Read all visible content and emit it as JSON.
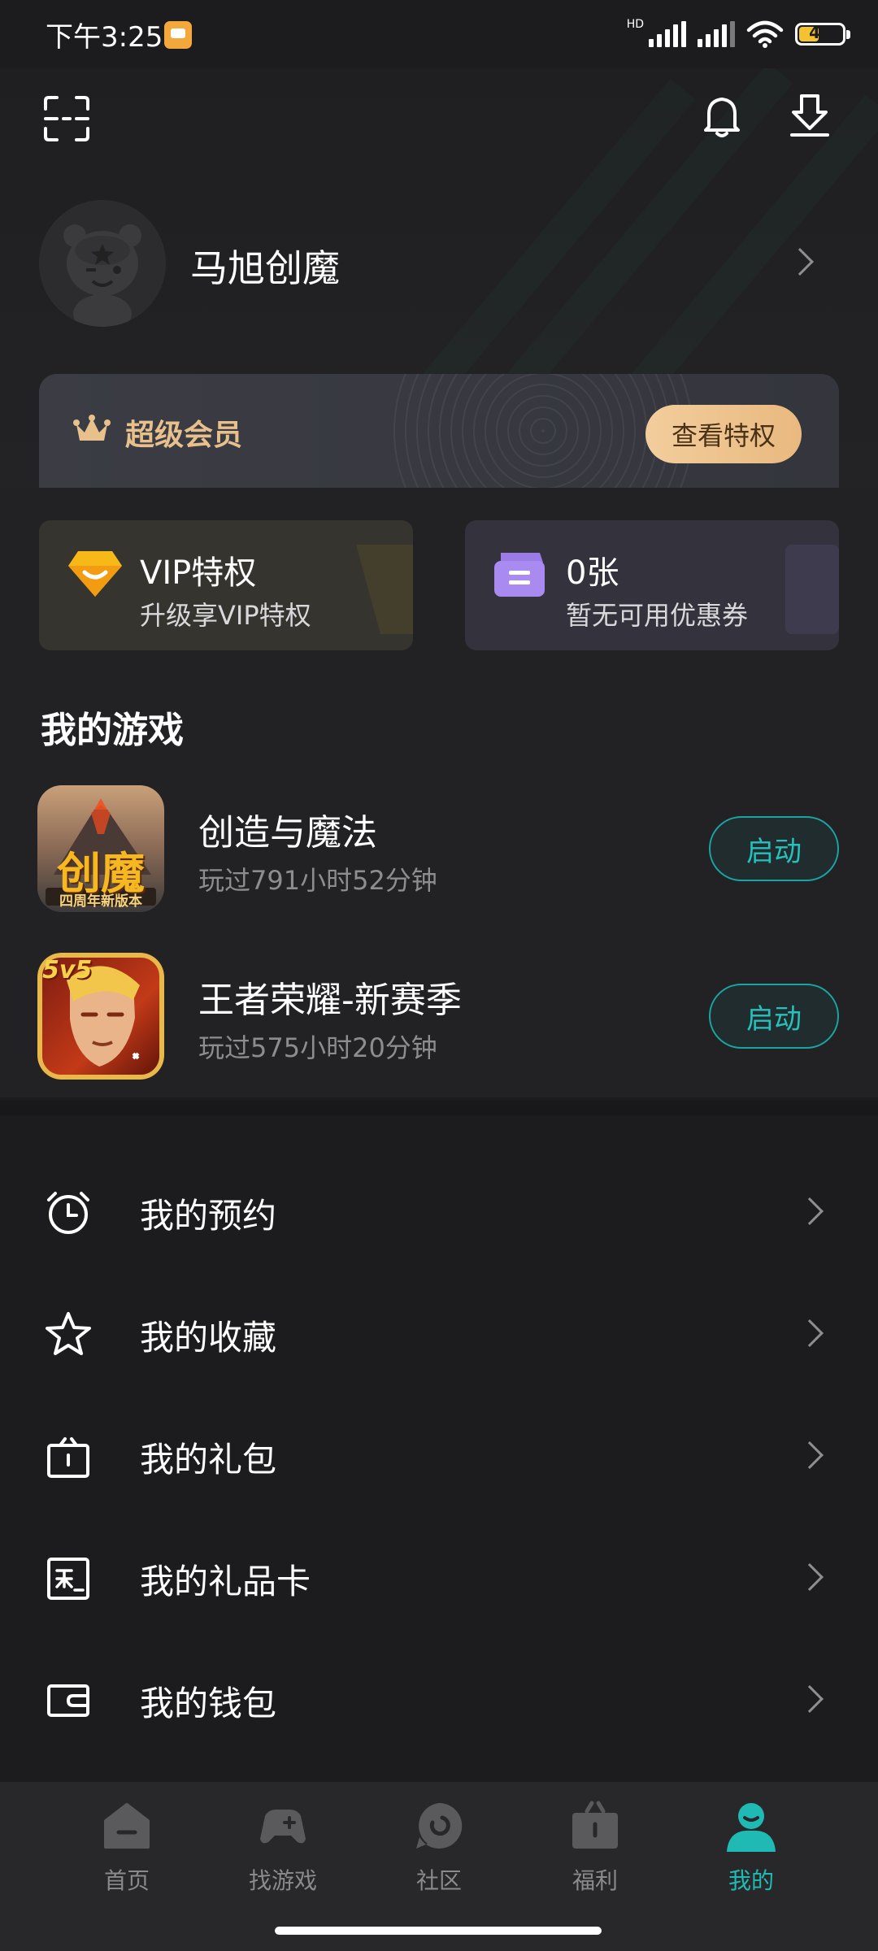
{
  "status_bar": {
    "time": "下午3:25",
    "hd": "HD",
    "battery": "47",
    "battery_level": 0.47
  },
  "header": {
    "scan_icon": "scan-icon",
    "bell_icon": "bell-icon",
    "download_icon": "download-icon"
  },
  "profile": {
    "username": "马旭创魔"
  },
  "vip_banner": {
    "title": "超级会员",
    "button": "查看特权"
  },
  "cards": [
    {
      "title": "VIP特权",
      "subtitle": "升级享VIP特权",
      "icon": "diamond-icon"
    },
    {
      "title": "0张",
      "subtitle": "暂无可用优惠券",
      "icon": "coupon-icon"
    }
  ],
  "my_games": {
    "title": "我的游戏",
    "items": [
      {
        "name": "创造与魔法",
        "played": "玩过791小时52分钟",
        "button": "启动",
        "icon_text": "创魔",
        "icon_caption": "四周年新版本"
      },
      {
        "name": "王者荣耀-新赛季",
        "played": "玩过575小时20分钟",
        "button": "启动",
        "icon_text": "5v5"
      }
    ]
  },
  "menu": [
    {
      "label": "我的预约",
      "icon": "alarm-clock-icon"
    },
    {
      "label": "我的收藏",
      "icon": "star-icon"
    },
    {
      "label": "我的礼包",
      "icon": "gift-box-icon"
    },
    {
      "label": "我的礼品卡",
      "icon": "gift-card-icon"
    },
    {
      "label": "我的钱包",
      "icon": "wallet-icon"
    }
  ],
  "tabbar": [
    {
      "label": "首页",
      "icon": "home-icon"
    },
    {
      "label": "找游戏",
      "icon": "gamepad-icon"
    },
    {
      "label": "社区",
      "icon": "community-icon"
    },
    {
      "label": "福利",
      "icon": "gift-icon"
    },
    {
      "label": "我的",
      "icon": "profile-icon",
      "active": true
    }
  ],
  "colors": {
    "accent": "#1fbab3",
    "vip_gold": "#e7c08c",
    "background": "#1c1c1e"
  }
}
